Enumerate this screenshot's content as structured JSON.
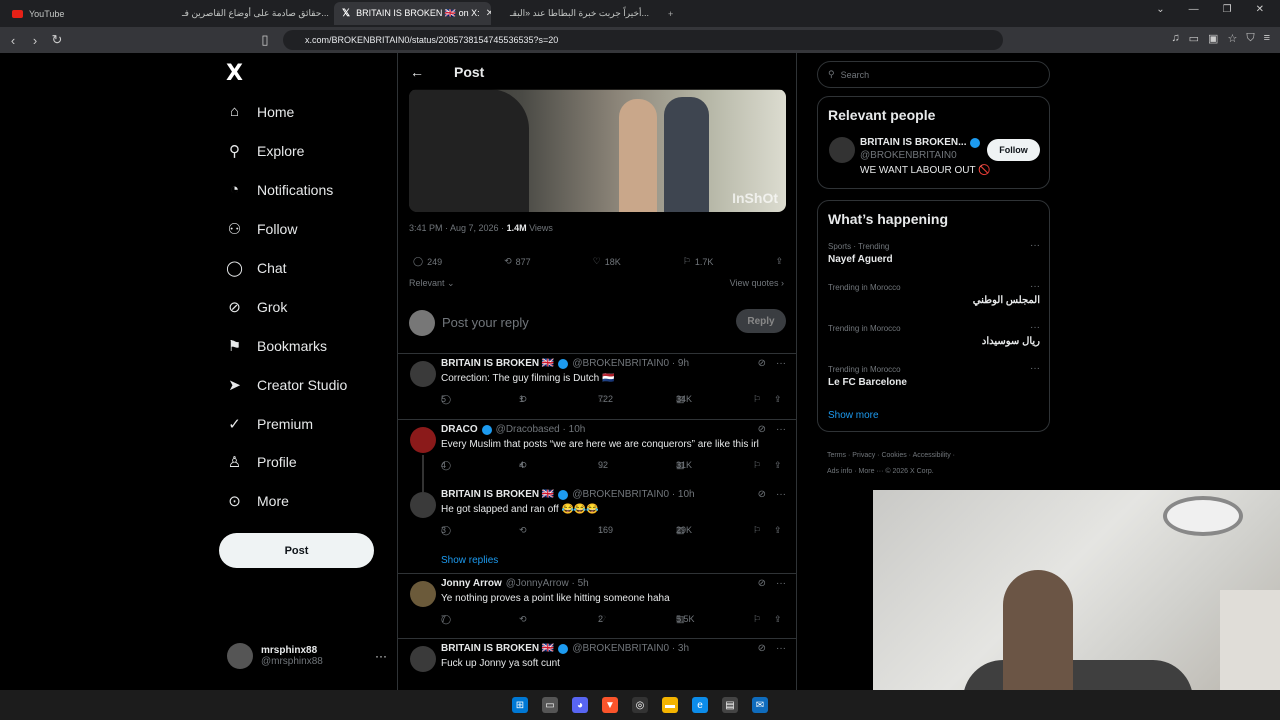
{
  "browser": {
    "tabs": [
      {
        "title": "YouTube",
        "icon": "youtube-icon"
      },
      {
        "title": "حقائق صادمة على أوضاع القاصرين فـ...",
        "icon": "youtube-icon"
      },
      {
        "title": "BRITAIN IS BROKEN 🇬🇧 on X:",
        "icon": "x-icon"
      },
      {
        "title": "أخيراً جربت خبرة البطاطا عند «البقـ...",
        "icon": "youtube-icon"
      }
    ],
    "url": "x.com/BROKENBRITAIN0/status/2085738154745536535?s=20"
  },
  "nav": {
    "logo": "X",
    "items": [
      {
        "label": "Home",
        "icon": "home-icon"
      },
      {
        "label": "Explore",
        "icon": "search-icon"
      },
      {
        "label": "Notifications",
        "icon": "bell-icon"
      },
      {
        "label": "Follow",
        "icon": "add-person-icon"
      },
      {
        "label": "Chat",
        "icon": "chat-icon"
      },
      {
        "label": "Grok",
        "icon": "grok-icon"
      },
      {
        "label": "Bookmarks",
        "icon": "bookmark-icon"
      },
      {
        "label": "Creator Studio",
        "icon": "rocket-icon"
      },
      {
        "label": "Premium",
        "icon": "verified-icon"
      },
      {
        "label": "Profile",
        "icon": "person-icon"
      },
      {
        "label": "More",
        "icon": "more-circle-icon"
      }
    ],
    "post_button": "Post",
    "account": {
      "name": "mrsphinx88",
      "handle": "@mrsphinx88"
    }
  },
  "post": {
    "header": "Post",
    "watermark": "InShOt",
    "time": "3:41 PM · Aug 7, 2026 · ",
    "views_count": "1.4M",
    "views_label": " Views",
    "stats": {
      "replies": "249",
      "reposts": "877",
      "likes": "18K",
      "bookmarks": "1.7K"
    },
    "relevant": "Relevant",
    "view_quotes": "View quotes",
    "reply_placeholder": "Post your reply",
    "reply_button": "Reply"
  },
  "replies": [
    {
      "name": "BRITAIN IS BROKEN 🇬🇧",
      "handle": "@BROKENBRITAIN0 · 9h",
      "text": "Correction: The guy filming is Dutch 🇳🇱",
      "replies": "5",
      "reposts": "1",
      "likes": "722",
      "views": "34K",
      "avatar": "#3a3a3a"
    },
    {
      "name": "DRACO",
      "handle": "@Dracobased · 10h",
      "text": "Every Muslim that posts “we are here we are conquerors” are like this irl",
      "replies": "4",
      "reposts": "4",
      "likes": "92",
      "views": "31K",
      "avatar": "#8b1a1a"
    },
    {
      "name": "BRITAIN IS BROKEN 🇬🇧",
      "handle": "@BROKENBRITAIN0 · 10h",
      "text": "He got slapped and ran off 😂😂😂",
      "replies": "3",
      "reposts": "",
      "likes": "169",
      "views": "29K",
      "avatar": "#3a3a3a"
    },
    {
      "name": "Jonny Arrow",
      "handle": "@JonnyArrow · 5h",
      "text": "Ye nothing proves a point like hitting someone haha",
      "replies": "7",
      "reposts": "",
      "likes": "2",
      "views": "5.5K",
      "avatar": "#6b5a3a"
    },
    {
      "name": "BRITAIN IS BROKEN 🇬🇧",
      "handle": "@BROKENBRITAIN0 · 3h",
      "text": "Fuck up Jonny ya soft cunt",
      "replies": "",
      "reposts": "",
      "likes": "",
      "views": "",
      "avatar": "#3a3a3a"
    }
  ],
  "show_replies": "Show replies",
  "sidebar": {
    "search_placeholder": "Search",
    "relevant_title": "Relevant people",
    "person": {
      "name": "BRITAIN IS BROKEN...",
      "handle": "@BROKENBRITAIN0",
      "bio": "WE WANT LABOUR OUT 🚫",
      "follow": "Follow"
    },
    "happening_title": "What’s happening",
    "trends": [
      {
        "cat": "Sports · Trending",
        "title": "Nayef Aguerd",
        "rtl": false
      },
      {
        "cat": "Trending in Morocco",
        "title": "المجلس الوطني",
        "rtl": true
      },
      {
        "cat": "Trending in Morocco",
        "title": "ريال سوسيداد",
        "rtl": true
      },
      {
        "cat": "Trending in Morocco",
        "title": "Le FC Barcelone",
        "rtl": false
      }
    ],
    "show_more": "Show more",
    "footer_line1": "Terms · Privacy · Cookies · Accessibility ·",
    "footer_line2": "Ads info · More ··· © 2026 X Corp."
  },
  "colors": {
    "accent": "#1d9bf0",
    "bg": "#000000",
    "border": "#2f3336",
    "muted": "#71767b"
  }
}
